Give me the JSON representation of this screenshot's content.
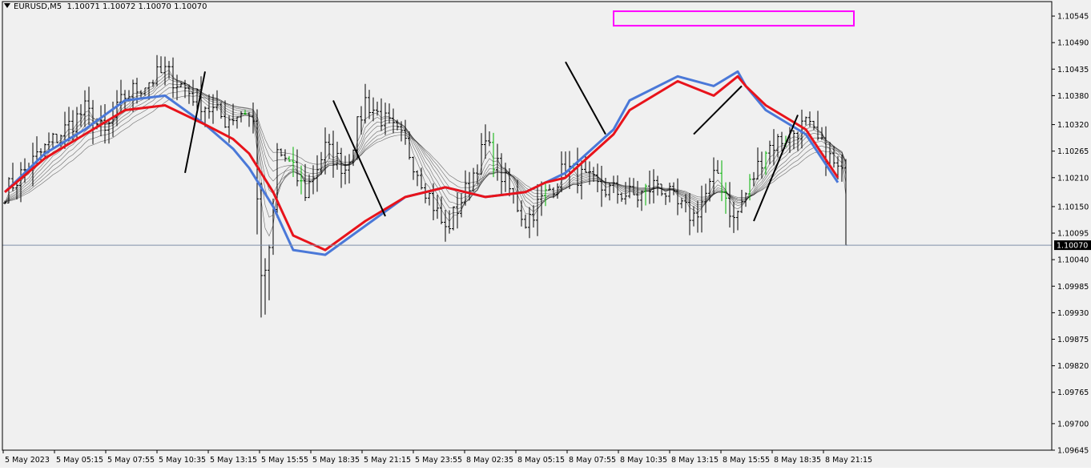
{
  "header": {
    "symbol": "EURUSD,M5",
    "ohlc": "1.10071 1.10072 1.10070 1.10070"
  },
  "colors": {
    "background": "#f0f0f0",
    "plot_border": "#000000",
    "bars": "#000000",
    "up_bar_accent": "#00b000",
    "ema_red": "#e8131b",
    "ema_blue": "#4a78d8",
    "ribbon": "#000000",
    "bid_line": "#7f8fa8",
    "box": "#ff00ff",
    "price_tag_bg": "#000000",
    "price_tag_text": "#ffffff"
  },
  "chart_data": {
    "type": "line",
    "title": "EURUSD,M5",
    "y_axis": {
      "ylim": [
        1.09645,
        1.10575
      ],
      "ticks": [
        "1.10545",
        "1.10490",
        "1.10435",
        "1.10380",
        "1.10320",
        "1.10265",
        "1.10210",
        "1.10150",
        "1.10095",
        "1.10040",
        "1.09985",
        "1.09930",
        "1.09875",
        "1.09820",
        "1.09765",
        "1.09700",
        "1.09645"
      ],
      "side": "right"
    },
    "x_axis": {
      "ticks": [
        "5 May 2023",
        "5 May 05:15",
        "5 May 07:55",
        "5 May 10:35",
        "5 May 13:15",
        "5 May 15:55",
        "5 May 18:35",
        "5 May 21:15",
        "5 May 23:55",
        "8 May 02:35",
        "8 May 05:15",
        "8 May 07:55",
        "8 May 10:35",
        "8 May 13:15",
        "8 May 15:55",
        "8 May 18:35",
        "8 May 21:15"
      ],
      "bars_total": 210
    },
    "current_price": "1.10070",
    "series": [
      {
        "name": "",
        "role": "price",
        "style": "ohlc-bars",
        "x": [
          0,
          10,
          20,
          25,
          30,
          40,
          50,
          55,
          60,
          65,
          70,
          75,
          80,
          85,
          90,
          100,
          110,
          115,
          120,
          130,
          140,
          148,
          158,
          163,
          168,
          172,
          178,
          182,
          190,
          200,
          210
        ],
        "y": [
          1.1018,
          1.1027,
          1.1035,
          1.103,
          1.1038,
          1.1043,
          1.1036,
          1.1033,
          1.1035,
          1.1028,
          1.1025,
          1.1018,
          1.1027,
          1.1023,
          1.1037,
          1.1028,
          1.101,
          1.1018,
          1.1028,
          1.1012,
          1.1023,
          1.1019,
          1.1017,
          1.102,
          1.1015,
          1.1013,
          1.1022,
          1.1012,
          1.1027,
          1.1032,
          1.102
        ]
      },
      {
        "name": "",
        "role": "ema-slow-red",
        "x": [
          0,
          10,
          20,
          30,
          40,
          50,
          57,
          61,
          67,
          72,
          80,
          90,
          100,
          110,
          115,
          120,
          130,
          135,
          140,
          152,
          156,
          168,
          177,
          183,
          185,
          190,
          200,
          208
        ],
        "y": [
          1.1018,
          1.1025,
          1.103,
          1.1035,
          1.1036,
          1.1032,
          1.1029,
          1.1026,
          1.1018,
          1.1009,
          1.1006,
          1.1012,
          1.1017,
          1.1019,
          1.1018,
          1.1017,
          1.1018,
          1.102,
          1.1021,
          1.103,
          1.1035,
          1.1041,
          1.1038,
          1.1042,
          1.104,
          1.1036,
          1.1031,
          1.1021
        ]
      },
      {
        "name": "",
        "role": "ema-slow-blue",
        "x": [
          0,
          10,
          20,
          30,
          40,
          50,
          57,
          61,
          67,
          72,
          80,
          90,
          100,
          110,
          115,
          120,
          130,
          135,
          140,
          152,
          156,
          168,
          177,
          183,
          185,
          190,
          200,
          208
        ],
        "y": [
          1.1018,
          1.1026,
          1.1031,
          1.1037,
          1.1038,
          1.1032,
          1.1027,
          1.1023,
          1.1015,
          1.1006,
          1.1005,
          1.1011,
          1.1017,
          1.1019,
          1.1018,
          1.1017,
          1.1018,
          1.102,
          1.1022,
          1.1031,
          1.1037,
          1.1042,
          1.104,
          1.1043,
          1.104,
          1.1035,
          1.103,
          1.102
        ]
      }
    ],
    "annotations": [
      {
        "type": "trendline",
        "from": [
          45,
          1.1022
        ],
        "to": [
          50,
          1.1043
        ]
      },
      {
        "type": "trendline",
        "from": [
          82,
          1.1037
        ],
        "to": [
          95,
          1.1013
        ]
      },
      {
        "type": "trendline",
        "from": [
          140,
          1.1045
        ],
        "to": [
          150,
          1.103
        ]
      },
      {
        "type": "trendline",
        "from": [
          172,
          1.103
        ],
        "to": [
          184,
          1.104
        ]
      },
      {
        "type": "trendline",
        "from": [
          187,
          1.1012
        ],
        "to": [
          198,
          1.1034
        ]
      },
      {
        "type": "rectangle",
        "from": [
          152,
          1.10555
        ],
        "to": [
          212,
          1.10525
        ]
      }
    ],
    "grid": false,
    "legend": "none"
  }
}
